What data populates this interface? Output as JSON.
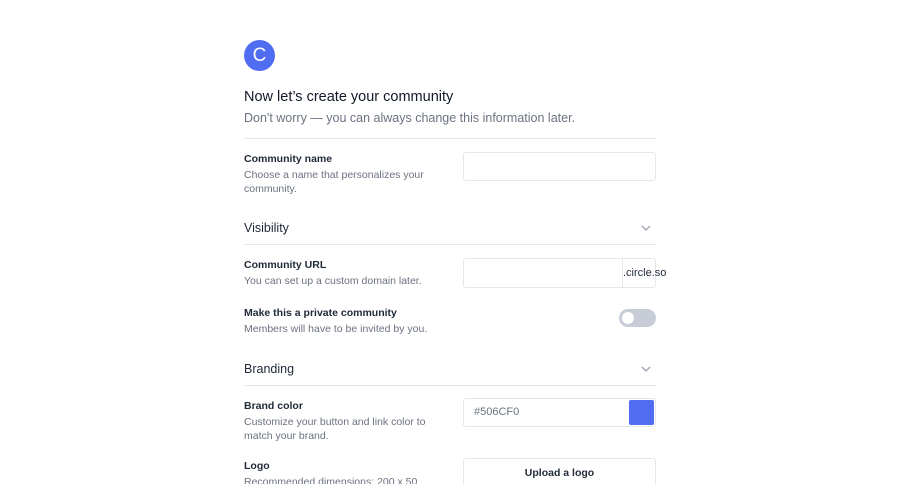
{
  "brand": {
    "avatar_letter": "C",
    "accent_color": "#506CF0"
  },
  "header": {
    "title": "Now let’s create your community",
    "subtitle": "Don't worry — you can always change this information later."
  },
  "community_name": {
    "label": "Community name",
    "description": "Choose a name that personalizes your community.",
    "value": ""
  },
  "visibility": {
    "section_title": "Visibility",
    "chevron_icon": "chevron-down-icon",
    "community_url": {
      "label": "Community URL",
      "description": "You can set up a custom domain later.",
      "value": "",
      "suffix": ".circle.so"
    },
    "private": {
      "label": "Make this a private community",
      "description": "Members will have to be invited by you.",
      "enabled": false
    }
  },
  "branding": {
    "section_title": "Branding",
    "chevron_icon": "chevron-down-icon",
    "brand_color": {
      "label": "Brand color",
      "description": "Customize your button and link color to match your brand.",
      "value": "#506CF0",
      "swatch_color": "#506CF0"
    },
    "logo": {
      "label": "Logo",
      "description": "Recommended dimensions: 200 x 50",
      "button_label": "Upload a logo"
    }
  }
}
